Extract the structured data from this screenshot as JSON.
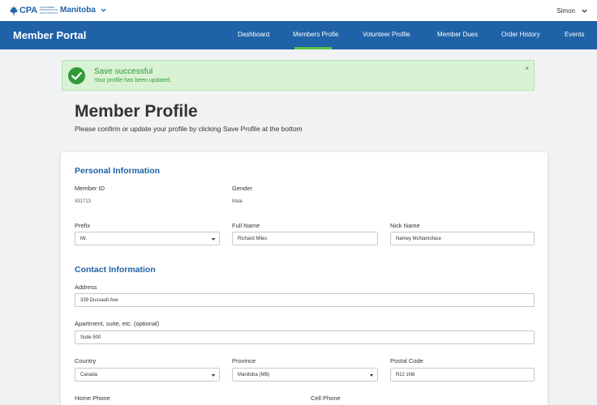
{
  "header": {
    "brand": "CPA",
    "brand_tag": "CHARTERED PROFESSIONAL ACCOUNTANTS",
    "province": "Manitoba",
    "user": "Simon",
    "icons": [
      "maple-leaf-icon",
      "chevron-down-icon"
    ]
  },
  "nav": {
    "title": "Member Portal",
    "items": [
      "Dashboard",
      "Members Profie",
      "Volunteer Profile",
      "Member Dues",
      "Order History",
      "Events"
    ],
    "active_index": 1
  },
  "alert": {
    "title": "Save successful",
    "text": "Your profile has been updated.",
    "close": "×"
  },
  "page": {
    "title": "Member Profile",
    "subtitle": "Please confirm or update your profile by clicking Save Profile at the bottom"
  },
  "personal": {
    "heading": "Personal Information",
    "member_id_label": "Member ID",
    "member_id": "431713",
    "gender_label": "Gender",
    "gender": "Male",
    "prefix_label": "Prefix",
    "prefix": "Mr.",
    "full_name_label": "Full Name",
    "full_name": "Richard Miles",
    "nick_name_label": "Nick Name",
    "nick_name": "Namey McNamoface"
  },
  "contact": {
    "heading": "Contact Information",
    "address_label": "Address",
    "address": "339 Dussault Ave",
    "apt_label": "Apartment, suite, etc. (optional)",
    "apt": "Suite 500",
    "country_label": "Country",
    "country": "Canada",
    "province_label": "Province",
    "province": "Manitoba (MB)",
    "postal_label": "Postal Code",
    "postal": "R2J 1N8",
    "home_phone_label": "Home Phone",
    "cell_phone_label": "Cell Phone"
  },
  "colors": {
    "brand_blue": "#1f62a8",
    "success_green": "#2f9a3a",
    "alert_bg": "#d9f2d4",
    "active_underline": "#57c43f"
  }
}
